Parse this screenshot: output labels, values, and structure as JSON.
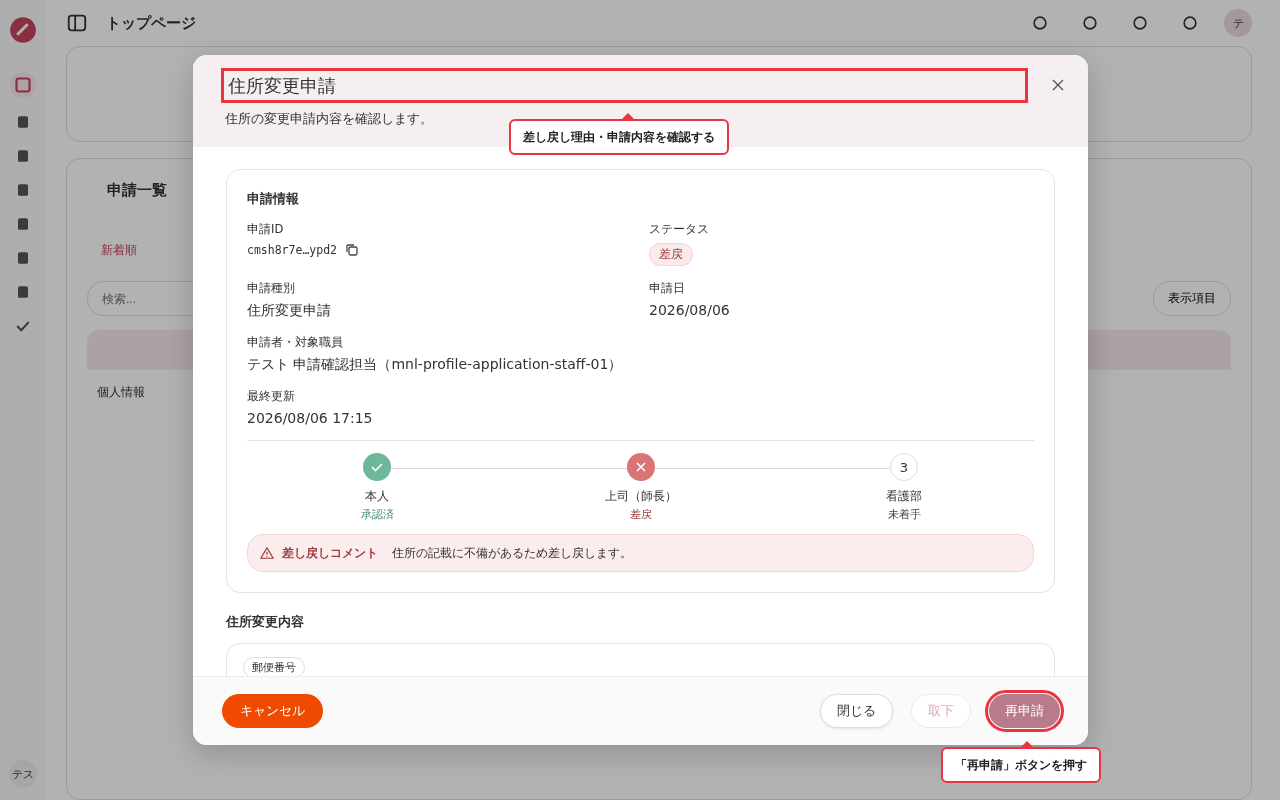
{
  "background": {
    "page_title": "トップページ",
    "list_title": "申請一覧",
    "sort_tab": "新着順",
    "search": {
      "placeholder": "検索..."
    },
    "columns_button": "表示項目",
    "row_category": "個人情報",
    "sidebar_avatar": "テス",
    "header_avatar": "テ"
  },
  "dialog": {
    "title": "住所変更申請",
    "title_highlighted": true,
    "subtitle": "住所の変更申請内容を確認します。",
    "info": {
      "heading": "申請情報",
      "fields": [
        {
          "label": "申請ID",
          "value": "cmsh8r7e…ypd2",
          "kind": "id"
        },
        {
          "label": "ステータス",
          "value": "差戻",
          "kind": "badge"
        },
        {
          "label": "申請種別",
          "value": "住所変更申請",
          "kind": "text"
        },
        {
          "label": "申請日",
          "value": "2026/08/06",
          "kind": "text"
        },
        {
          "label": "申請者・対象職員",
          "value": "テスト 申請確認担当（mnl-profile-application-staff-01）",
          "kind": "wide"
        },
        {
          "label": "最終更新",
          "value": "2026/08/06 17:15",
          "kind": "wide"
        }
      ],
      "steps": [
        {
          "name": "本人",
          "status_text": "承認済",
          "kind": "approved"
        },
        {
          "name": "上司（師長）",
          "status_text": "差戻",
          "kind": "returned"
        },
        {
          "name": "看護部",
          "status_text": "未着手",
          "kind": "pending",
          "number": "3"
        }
      ],
      "comment": {
        "label": "差し戻しコメント",
        "text": "住所の記載に不備があるため差し戻します。"
      }
    },
    "section_title": "住所変更内容",
    "first_field_label": "郵便番号",
    "buttons": [
      {
        "label": "キャンセル",
        "kind": "cancel",
        "disabled": false,
        "highlighted": false
      },
      {
        "label": "閉じる",
        "kind": "outline",
        "disabled": false,
        "highlighted": false
      },
      {
        "label": "取下",
        "kind": "outline",
        "disabled": true,
        "highlighted": false
      },
      {
        "label": "再申請",
        "kind": "primary",
        "disabled": false,
        "highlighted": true
      }
    ]
  },
  "callouts": [
    "差し戻し理由・申請内容を確認する",
    "「再申請」ボタンを押す"
  ]
}
